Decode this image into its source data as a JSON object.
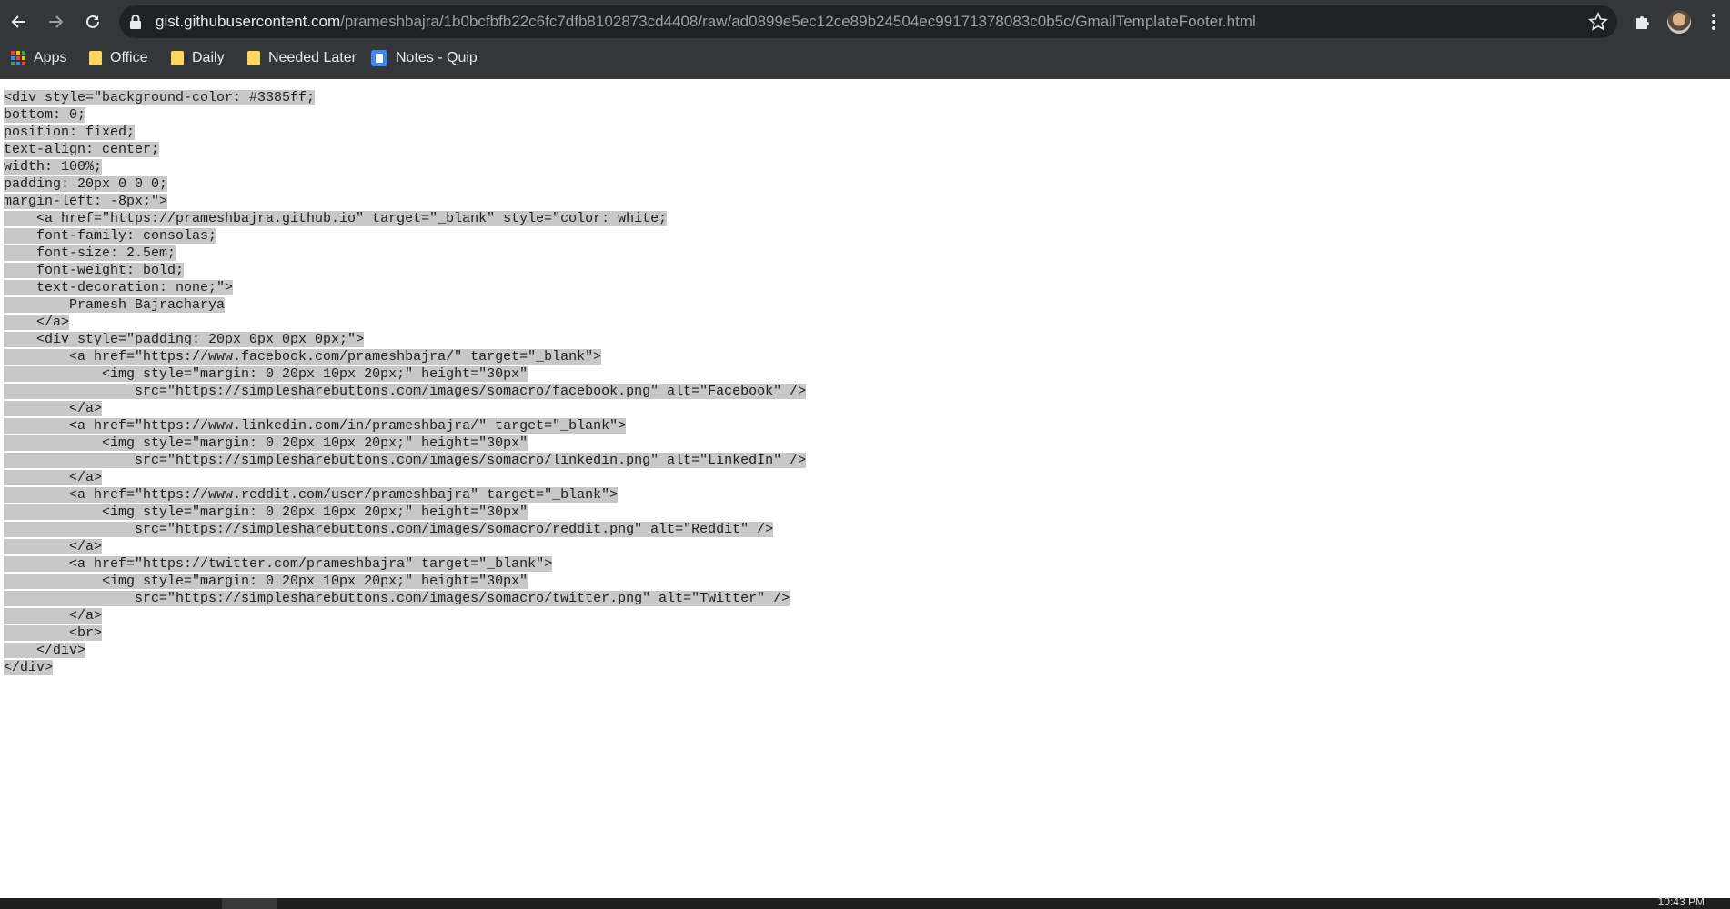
{
  "browser": {
    "url_host": "gist.githubusercontent.com",
    "url_path": "/prameshbajra/1b0bcfbfb22c6fc7dfb8102873cd4408/raw/ad0899e5ec12ce89b24504ec99171378083c0b5c/GmailTemplateFooter.html",
    "icons": [
      "back-icon",
      "forward-icon",
      "reload-icon",
      "lock-icon",
      "star-icon",
      "extensions-icon",
      "profile-avatar",
      "menu-icon"
    ]
  },
  "bookmarks": [
    {
      "label": "Apps",
      "icon": "apps-icon"
    },
    {
      "label": "Office",
      "icon": "folder-icon"
    },
    {
      "label": "Daily",
      "icon": "folder-icon"
    },
    {
      "label": "Needed Later",
      "icon": "folder-icon"
    },
    {
      "label": "Notes - Quip",
      "icon": "quip-icon"
    }
  ],
  "code_lines": [
    "<div style=\"background-color: #3385ff;",
    "bottom: 0;",
    "position: fixed;",
    "text-align: center;",
    "width: 100%;",
    "padding: 20px 0 0 0;",
    "margin-left: -8px;\">",
    "    <a href=\"https://prameshbajra.github.io\" target=\"_blank\" style=\"color: white;",
    "    font-family: consolas;",
    "    font-size: 2.5em;",
    "    font-weight: bold;",
    "    text-decoration: none;\">",
    "        Pramesh Bajracharya",
    "    </a>",
    "    <div style=\"padding: 20px 0px 0px 0px;\">",
    "        <a href=\"https://www.facebook.com/prameshbajra/\" target=\"_blank\">",
    "            <img style=\"margin: 0 20px 10px 20px;\" height=\"30px\"",
    "                src=\"https://simplesharebuttons.com/images/somacro/facebook.png\" alt=\"Facebook\" />",
    "        </a>",
    "        <a href=\"https://www.linkedin.com/in/prameshbajra/\" target=\"_blank\">",
    "            <img style=\"margin: 0 20px 10px 20px;\" height=\"30px\"",
    "                src=\"https://simplesharebuttons.com/images/somacro/linkedin.png\" alt=\"LinkedIn\" />",
    "        </a>",
    "        <a href=\"https://www.reddit.com/user/prameshbajra\" target=\"_blank\">",
    "            <img style=\"margin: 0 20px 10px 20px;\" height=\"30px\"",
    "                src=\"https://simplesharebuttons.com/images/somacro/reddit.png\" alt=\"Reddit\" />",
    "        </a>",
    "        <a href=\"https://twitter.com/prameshbajra\" target=\"_blank\">",
    "            <img style=\"margin: 0 20px 10px 20px;\" height=\"30px\"",
    "                src=\"https://simplesharebuttons.com/images/somacro/twitter.png\" alt=\"Twitter\" />",
    "        </a>",
    "        <br>",
    "    </div>",
    "</div>"
  ],
  "taskbar": {
    "clock": "10:43 PM"
  },
  "colors": {
    "chrome_bg": "#35363a",
    "omnibox_bg": "#202124",
    "selection": "#c8c8c8"
  }
}
